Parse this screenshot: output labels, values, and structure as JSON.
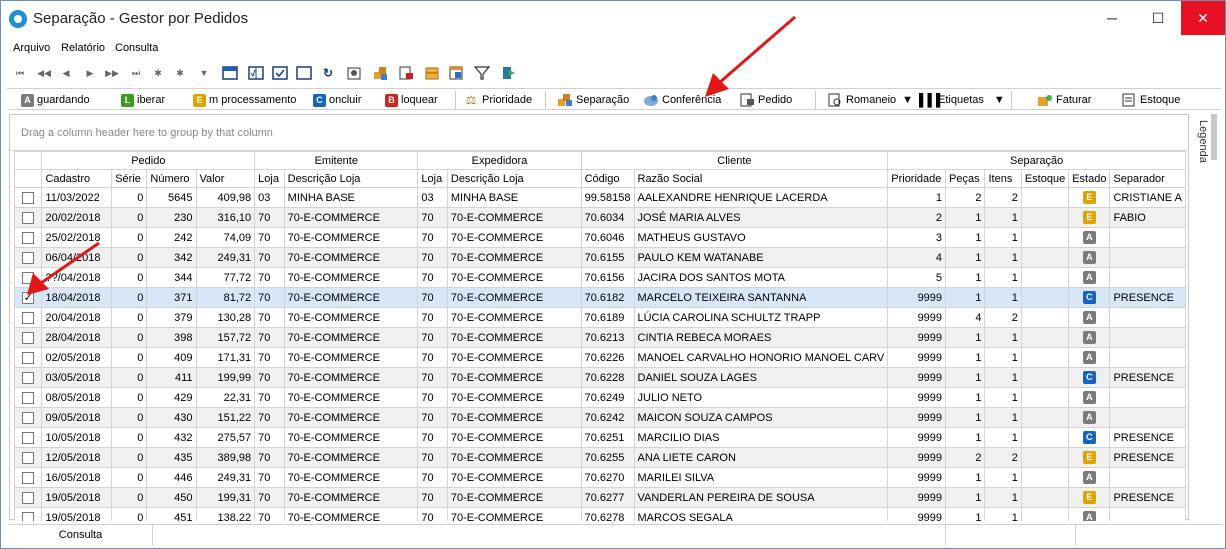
{
  "window": {
    "title": "Separação - Gestor por Pedidos",
    "controls": {
      "minimize": "─",
      "maximize": "☐",
      "close": "✕"
    }
  },
  "menu": [
    "Arquivo",
    "Relatório",
    "Consulta"
  ],
  "toolbar_nav": [
    "⏮",
    "◀◀",
    "◀",
    "▶",
    "▶▶",
    "⏭",
    "✱",
    "✱",
    "▼"
  ],
  "actions": {
    "aguardando": {
      "letter": "A",
      "label": "guardando",
      "color": "#7b7b7b"
    },
    "liberar": {
      "letter": "L",
      "label": "iberar",
      "color": "#3a9b1e"
    },
    "em_processamento": {
      "letter": "E",
      "label": "m processamento",
      "color": "#e0a300"
    },
    "concluir": {
      "letter": "C",
      "label": "oncluir",
      "color": "#1565c0"
    },
    "bloquear": {
      "letter": "B",
      "label": "loquear",
      "color": "#d4231e"
    },
    "prioridade": "Prioridade",
    "separacao": "Separação",
    "conferencia": "Conferência",
    "pedido": "Pedido",
    "romaneio": "Romaneio",
    "etiquetas": "Etiquetas",
    "faturar": "Faturar",
    "estoque": "Estoque"
  },
  "grid": {
    "group_hint": "Drag a column header here to group by that column",
    "bands": [
      "Pedido",
      "Emitente",
      "Expedidora",
      "Cliente",
      "Separação"
    ],
    "columns": [
      "Cadastro",
      "Série",
      "Número",
      "Valor",
      "Loja",
      "Descrição Loja",
      "Loja",
      "Descrição Loja",
      "Código",
      "Razão Social",
      "Prioridade",
      "Peças",
      "Itens",
      "Estoque",
      "Estado",
      "Separador"
    ],
    "rows": [
      {
        "checked": false,
        "cadastro": "11/03/2022",
        "serie": "0",
        "numero": "5645",
        "valor": "409,98",
        "loja_e": "03",
        "desc_e": "MINHA BASE",
        "loja_x": "03",
        "desc_x": "MINHA BASE",
        "codigo": "99.58158",
        "razao": "AALEXANDRE   HENRIQUE  LACERDA",
        "prioridade": "1",
        "pecas": "2",
        "itens": "2",
        "estoque": "",
        "estado": "E",
        "separador": "CRISTIANE A"
      },
      {
        "checked": false,
        "cadastro": "20/02/2018",
        "serie": "0",
        "numero": "230",
        "valor": "316,10",
        "loja_e": "70",
        "desc_e": "70-E-COMMERCE",
        "loja_x": "70",
        "desc_x": "70-E-COMMERCE",
        "codigo": "70.6034",
        "razao": "JOSÉ MARIA ALVES",
        "prioridade": "2",
        "pecas": "1",
        "itens": "1",
        "estoque": "",
        "estado": "E",
        "separador": "FABIO"
      },
      {
        "checked": false,
        "cadastro": "25/02/2018",
        "serie": "0",
        "numero": "242",
        "valor": "74,09",
        "loja_e": "70",
        "desc_e": "70-E-COMMERCE",
        "loja_x": "70",
        "desc_x": "70-E-COMMERCE",
        "codigo": "70.6046",
        "razao": "MATHEUS GUSTAVO",
        "prioridade": "3",
        "pecas": "1",
        "itens": "1",
        "estoque": "",
        "estado": "A",
        "separador": ""
      },
      {
        "checked": false,
        "cadastro": "06/04/2018",
        "serie": "0",
        "numero": "342",
        "valor": "249,31",
        "loja_e": "70",
        "desc_e": "70-E-COMMERCE",
        "loja_x": "70",
        "desc_x": "70-E-COMMERCE",
        "codigo": "70.6155",
        "razao": "PAULO KEM WATANABE",
        "prioridade": "4",
        "pecas": "1",
        "itens": "1",
        "estoque": "",
        "estado": "A",
        "separador": ""
      },
      {
        "checked": false,
        "cadastro": "??/04/2018",
        "serie": "0",
        "numero": "344",
        "valor": "77,72",
        "loja_e": "70",
        "desc_e": "70-E-COMMERCE",
        "loja_x": "70",
        "desc_x": "70-E-COMMERCE",
        "codigo": "70.6156",
        "razao": "JACIRA DOS SANTOS MOTA",
        "prioridade": "5",
        "pecas": "1",
        "itens": "1",
        "estoque": "",
        "estado": "A",
        "separador": ""
      },
      {
        "checked": true,
        "cadastro": "18/04/2018",
        "serie": "0",
        "numero": "371",
        "valor": "81,72",
        "loja_e": "70",
        "desc_e": "70-E-COMMERCE",
        "loja_x": "70",
        "desc_x": "70-E-COMMERCE",
        "codigo": "70.6182",
        "razao": "MARCELO TEIXEIRA SANTANNA",
        "prioridade": "9999",
        "pecas": "1",
        "itens": "1",
        "estoque": "",
        "estado": "C",
        "separador": "PRESENCE"
      },
      {
        "checked": false,
        "cadastro": "20/04/2018",
        "serie": "0",
        "numero": "379",
        "valor": "130,28",
        "loja_e": "70",
        "desc_e": "70-E-COMMERCE",
        "loja_x": "70",
        "desc_x": "70-E-COMMERCE",
        "codigo": "70.6189",
        "razao": "LÚCIA CAROLINA SCHULTZ TRAPP",
        "prioridade": "9999",
        "pecas": "4",
        "itens": "2",
        "estoque": "",
        "estado": "A",
        "separador": ""
      },
      {
        "checked": false,
        "cadastro": "28/04/2018",
        "serie": "0",
        "numero": "398",
        "valor": "157,72",
        "loja_e": "70",
        "desc_e": "70-E-COMMERCE",
        "loja_x": "70",
        "desc_x": "70-E-COMMERCE",
        "codigo": "70.6213",
        "razao": "CINTIA REBECA MORAES",
        "prioridade": "9999",
        "pecas": "1",
        "itens": "1",
        "estoque": "",
        "estado": "A",
        "separador": ""
      },
      {
        "checked": false,
        "cadastro": "02/05/2018",
        "serie": "0",
        "numero": "409",
        "valor": "171,31",
        "loja_e": "70",
        "desc_e": "70-E-COMMERCE",
        "loja_x": "70",
        "desc_x": "70-E-COMMERCE",
        "codigo": "70.6226",
        "razao": "MANOEL CARVALHO HONORIO MANOEL CARV",
        "prioridade": "9999",
        "pecas": "1",
        "itens": "1",
        "estoque": "",
        "estado": "A",
        "separador": ""
      },
      {
        "checked": false,
        "cadastro": "03/05/2018",
        "serie": "0",
        "numero": "411",
        "valor": "199,99",
        "loja_e": "70",
        "desc_e": "70-E-COMMERCE",
        "loja_x": "70",
        "desc_x": "70-E-COMMERCE",
        "codigo": "70.6228",
        "razao": "DANIEL SOUZA LAGES",
        "prioridade": "9999",
        "pecas": "1",
        "itens": "1",
        "estoque": "",
        "estado": "C",
        "separador": "PRESENCE"
      },
      {
        "checked": false,
        "cadastro": "08/05/2018",
        "serie": "0",
        "numero": "429",
        "valor": "22,31",
        "loja_e": "70",
        "desc_e": "70-E-COMMERCE",
        "loja_x": "70",
        "desc_x": "70-E-COMMERCE",
        "codigo": "70.6249",
        "razao": "JULIO NETO",
        "prioridade": "9999",
        "pecas": "1",
        "itens": "1",
        "estoque": "",
        "estado": "A",
        "separador": ""
      },
      {
        "checked": false,
        "cadastro": "09/05/2018",
        "serie": "0",
        "numero": "430",
        "valor": "151,22",
        "loja_e": "70",
        "desc_e": "70-E-COMMERCE",
        "loja_x": "70",
        "desc_x": "70-E-COMMERCE",
        "codigo": "70.6242",
        "razao": "MAICON SOUZA CAMPOS",
        "prioridade": "9999",
        "pecas": "1",
        "itens": "1",
        "estoque": "",
        "estado": "A",
        "separador": ""
      },
      {
        "checked": false,
        "cadastro": "10/05/2018",
        "serie": "0",
        "numero": "432",
        "valor": "275,57",
        "loja_e": "70",
        "desc_e": "70-E-COMMERCE",
        "loja_x": "70",
        "desc_x": "70-E-COMMERCE",
        "codigo": "70.6251",
        "razao": "MARCILIO DIAS",
        "prioridade": "9999",
        "pecas": "1",
        "itens": "1",
        "estoque": "",
        "estado": "C",
        "separador": "PRESENCE"
      },
      {
        "checked": false,
        "cadastro": "12/05/2018",
        "serie": "0",
        "numero": "435",
        "valor": "389,98",
        "loja_e": "70",
        "desc_e": "70-E-COMMERCE",
        "loja_x": "70",
        "desc_x": "70-E-COMMERCE",
        "codigo": "70.6255",
        "razao": "ANA LIETE CARON",
        "prioridade": "9999",
        "pecas": "2",
        "itens": "2",
        "estoque": "",
        "estado": "E",
        "separador": "PRESENCE"
      },
      {
        "checked": false,
        "cadastro": "16/05/2018",
        "serie": "0",
        "numero": "446",
        "valor": "249,31",
        "loja_e": "70",
        "desc_e": "70-E-COMMERCE",
        "loja_x": "70",
        "desc_x": "70-E-COMMERCE",
        "codigo": "70.6270",
        "razao": "MARILEI SILVA",
        "prioridade": "9999",
        "pecas": "1",
        "itens": "1",
        "estoque": "",
        "estado": "A",
        "separador": ""
      },
      {
        "checked": false,
        "cadastro": "19/05/2018",
        "serie": "0",
        "numero": "450",
        "valor": "199,31",
        "loja_e": "70",
        "desc_e": "70-E-COMMERCE",
        "loja_x": "70",
        "desc_x": "70-E-COMMERCE",
        "codigo": "70.6277",
        "razao": "VANDERLAN PEREIRA DE SOUSA",
        "prioridade": "9999",
        "pecas": "1",
        "itens": "1",
        "estoque": "",
        "estado": "E",
        "separador": "PRESENCE"
      },
      {
        "checked": false,
        "cadastro": "19/05/2018",
        "serie": "0",
        "numero": "451",
        "valor": "138,22",
        "loja_e": "70",
        "desc_e": "70-E-COMMERCE",
        "loja_x": "70",
        "desc_x": "70-E-COMMERCE",
        "codigo": "70.6278",
        "razao": "MARCOS SEGALA",
        "prioridade": "9999",
        "pecas": "1",
        "itens": "1",
        "estoque": "",
        "estado": "A",
        "separador": ""
      }
    ]
  },
  "legend": "Legenda",
  "status": {
    "tab": "Consulta"
  }
}
